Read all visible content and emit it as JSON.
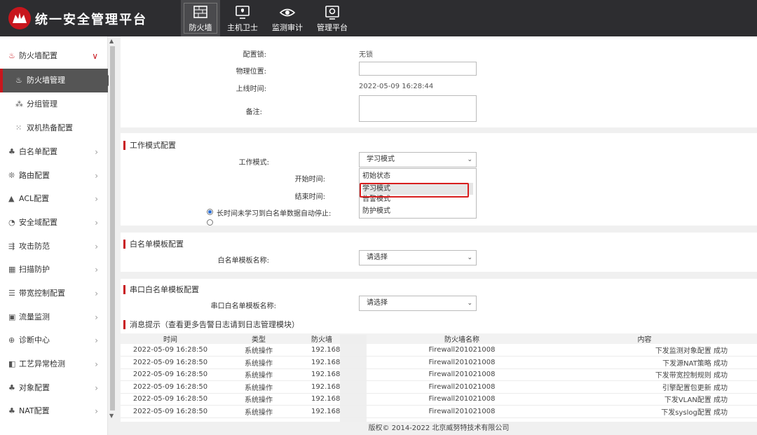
{
  "header": {
    "app_title": "统一安全管理平台",
    "nav": [
      {
        "label": "防火墙",
        "icon": "firewall-icon",
        "active": true
      },
      {
        "label": "主机卫士",
        "icon": "monitor-icon",
        "active": false
      },
      {
        "label": "监测审计",
        "icon": "eye-icon",
        "active": false
      },
      {
        "label": "管理平台",
        "icon": "gear-screen-icon",
        "active": false
      }
    ]
  },
  "sidebar": {
    "items": [
      {
        "label": "防火墙配置",
        "icon": "firewall-icon",
        "chevron": "∨"
      },
      {
        "label": "防火墙管理",
        "icon": "firewall-icon"
      },
      {
        "label": "分组管理",
        "icon": "tree-icon"
      },
      {
        "label": "双机热备配置",
        "icon": "network-icon"
      },
      {
        "label": "白名单配置",
        "icon": "whitelist-icon"
      },
      {
        "label": "路由配置",
        "icon": "route-icon"
      },
      {
        "label": "ACL配置",
        "icon": "acl-icon"
      },
      {
        "label": "安全域配置",
        "icon": "domain-icon"
      },
      {
        "label": "攻击防范",
        "icon": "attack-icon"
      },
      {
        "label": "扫描防护",
        "icon": "scan-icon"
      },
      {
        "label": "带宽控制配置",
        "icon": "bandwidth-icon"
      },
      {
        "label": "流量监测",
        "icon": "traffic-icon"
      },
      {
        "label": "诊断中心",
        "icon": "diagnose-icon"
      },
      {
        "label": "工艺异常检测",
        "icon": "process-icon"
      },
      {
        "label": "对象配置",
        "icon": "object-icon"
      },
      {
        "label": "NAT配置",
        "icon": "nat-icon"
      }
    ]
  },
  "basic": {
    "config_lock_label": "配置锁:",
    "config_lock_value": "无锁",
    "location_label": "物理位置:",
    "location_value": "",
    "online_time_label": "上线时间:",
    "online_time_value": "2022-05-09 16:28:44",
    "remark_label": "备注:",
    "remark_value": ""
  },
  "work_mode": {
    "section_title": "工作模式配置",
    "mode_label": "工作模式:",
    "mode_value": "学习模式",
    "start_label": "开始时间:",
    "end_label": "结束时间:",
    "auto_stop_label": "长时间未学习到白名单数据自动停止:",
    "options": [
      "初始状态",
      "学习模式",
      "告警模式",
      "防护模式"
    ],
    "highlighted_option": "学习模式"
  },
  "whitelist_template": {
    "section_title": "白名单模板配置",
    "name_label": "白名单模板名称:",
    "select_value": "请选择"
  },
  "serial_whitelist_template": {
    "section_title": "串口白名单模板配置",
    "name_label": "串口白名单模板名称:",
    "select_value": "请选择"
  },
  "messages": {
    "section_title": "消息提示（查看更多告警日志请到日志管理模块）",
    "columns": [
      "时间",
      "类型",
      "防火墙",
      "防火墙名称",
      "内容"
    ],
    "rows": [
      [
        "2022-05-09 16:28:50",
        "系统操作",
        "192.168",
        "Firewall201021008",
        "下发监测对象配置 成功"
      ],
      [
        "2022-05-09 16:28:50",
        "系统操作",
        "192.168",
        "Firewall201021008",
        "下发源NAT策略 成功"
      ],
      [
        "2022-05-09 16:28:50",
        "系统操作",
        "192.168",
        "Firewall201021008",
        "下发带宽控制规则 成功"
      ],
      [
        "2022-05-09 16:28:50",
        "系统操作",
        "192.168",
        "Firewall201021008",
        "引擎配置包更新 成功"
      ],
      [
        "2022-05-09 16:28:50",
        "系统操作",
        "192.168",
        "Firewall201021008",
        "下发VLAN配置 成功"
      ],
      [
        "2022-05-09 16:28:50",
        "系统操作",
        "192.168",
        "Firewall201021008",
        "下发syslog配置 成功"
      ]
    ]
  },
  "footer": {
    "copyright": "版权© 2014-2022 北京威努特技术有限公司"
  },
  "colors": {
    "accent": "#c8161d",
    "topbar": "#2d2d30",
    "active_sidebar": "#555555"
  }
}
